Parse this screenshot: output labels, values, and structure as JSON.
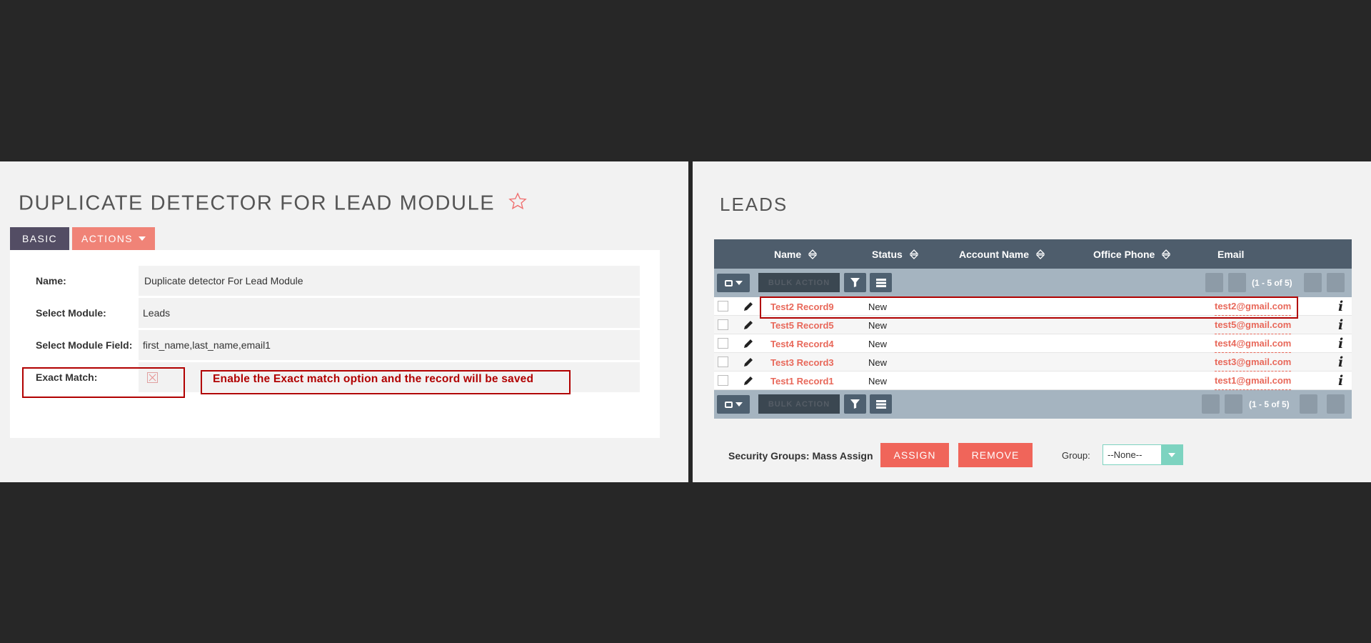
{
  "left": {
    "title": "DUPLICATE DETECTOR FOR LEAD MODULE",
    "tabs": {
      "basic": "BASIC",
      "actions": "ACTIONS"
    },
    "fields": [
      {
        "label": "Name:",
        "value": "Duplicate detector For Lead Module"
      },
      {
        "label": "Select Module:",
        "value": "Leads"
      },
      {
        "label": "Select Module Field:",
        "value": "first_name,last_name,email1"
      },
      {
        "label": "Exact Match:",
        "value": ""
      }
    ],
    "annotation": "Enable the Exact match option and the record will be saved"
  },
  "right": {
    "title": "LEADS",
    "columns": [
      "Name",
      "Status",
      "Account Name",
      "Office Phone",
      "Email"
    ],
    "toolbar": {
      "bulk_action": "BULK ACTION",
      "pagination": "(1 - 5 of 5)"
    },
    "rows": [
      {
        "name": "Test2 Record9",
        "status": "New",
        "email": "test2@gmail.com"
      },
      {
        "name": "Test5 Record5",
        "status": "New",
        "email": "test5@gmail.com"
      },
      {
        "name": "Test4 Record4",
        "status": "New",
        "email": "test4@gmail.com"
      },
      {
        "name": "Test3 Record3",
        "status": "New",
        "email": "test3@gmail.com"
      },
      {
        "name": "Test1 Record1",
        "status": "New",
        "email": "test1@gmail.com"
      }
    ],
    "mass_assign": {
      "label": "Security Groups: Mass Assign",
      "assign": "ASSIGN",
      "remove": "REMOVE",
      "group_label": "Group:",
      "group_value": "--None--"
    }
  },
  "colors": {
    "accent": "#f0655a",
    "header": "#4e5d6c",
    "annotation": "#b10000"
  }
}
